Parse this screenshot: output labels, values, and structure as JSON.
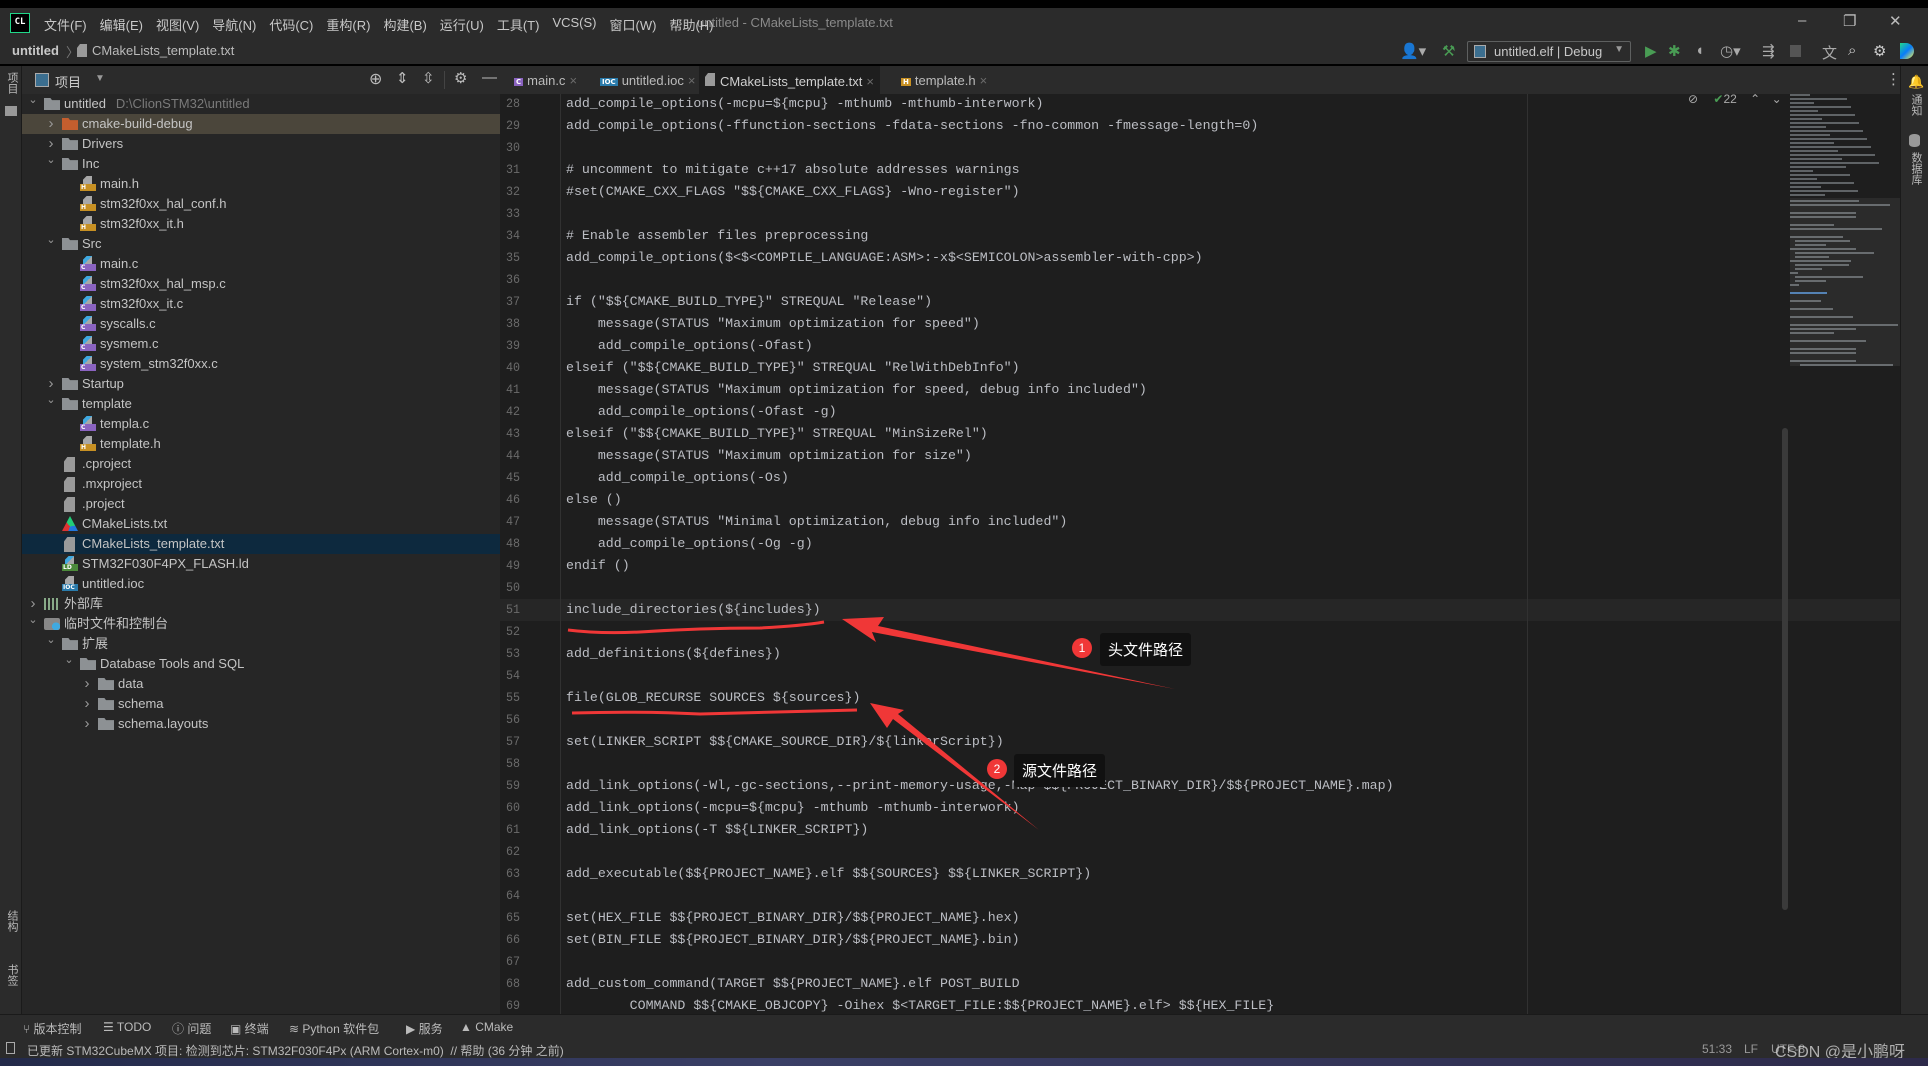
{
  "app": {
    "logo_text": "CL",
    "window_title": "untitled - CMakeLists_template.txt",
    "menu": [
      "文件(F)",
      "编辑(E)",
      "视图(V)",
      "导航(N)",
      "代码(C)",
      "重构(R)",
      "构建(B)",
      "运行(U)",
      "工具(T)",
      "VCS(S)",
      "窗口(W)",
      "帮助(H)"
    ],
    "window_controls": {
      "minimize": "–",
      "restore": "❐",
      "close": "✕"
    }
  },
  "breadcrumb": {
    "project": "untitled",
    "file": "CMakeLists_template.txt"
  },
  "toolbar": {
    "run_config": "untitled.elf | Debug",
    "accent_run": "#499c54"
  },
  "project_panel": {
    "title": "项目",
    "tree": [
      {
        "label": "untitled",
        "extra": "D:\\ClionSTM32\\untitled",
        "level": 0,
        "type": "folder",
        "chev": "open"
      },
      {
        "label": "cmake-build-debug",
        "level": 1,
        "type": "folder-orange",
        "chev": "closed",
        "state": "highlight"
      },
      {
        "label": "Drivers",
        "level": 1,
        "type": "folder",
        "chev": "closed"
      },
      {
        "label": "Inc",
        "level": 1,
        "type": "folder",
        "chev": "open"
      },
      {
        "label": "main.h",
        "level": 2,
        "type": "h"
      },
      {
        "label": "stm32f0xx_hal_conf.h",
        "level": 2,
        "type": "h"
      },
      {
        "label": "stm32f0xx_it.h",
        "level": 2,
        "type": "h"
      },
      {
        "label": "Src",
        "level": 1,
        "type": "folder",
        "chev": "open"
      },
      {
        "label": "main.c",
        "level": 2,
        "type": "c"
      },
      {
        "label": "stm32f0xx_hal_msp.c",
        "level": 2,
        "type": "c"
      },
      {
        "label": "stm32f0xx_it.c",
        "level": 2,
        "type": "c"
      },
      {
        "label": "syscalls.c",
        "level": 2,
        "type": "c"
      },
      {
        "label": "sysmem.c",
        "level": 2,
        "type": "c"
      },
      {
        "label": "system_stm32f0xx.c",
        "level": 2,
        "type": "c"
      },
      {
        "label": "Startup",
        "level": 1,
        "type": "folder",
        "chev": "closed"
      },
      {
        "label": "template",
        "level": 1,
        "type": "folder",
        "chev": "open"
      },
      {
        "label": "templa.c",
        "level": 2,
        "type": "c"
      },
      {
        "label": "template.h",
        "level": 2,
        "type": "h"
      },
      {
        "label": ".cproject",
        "level": 1,
        "type": "txt"
      },
      {
        "label": ".mxproject",
        "level": 1,
        "type": "txt"
      },
      {
        "label": ".project",
        "level": 1,
        "type": "txt"
      },
      {
        "label": "CMakeLists.txt",
        "level": 1,
        "type": "cmake"
      },
      {
        "label": "CMakeLists_template.txt",
        "level": 1,
        "type": "txt",
        "state": "selected"
      },
      {
        "label": "STM32F030F4PX_FLASH.ld",
        "level": 1,
        "type": "ld"
      },
      {
        "label": "untitled.ioc",
        "level": 1,
        "type": "ioc"
      },
      {
        "label": "外部库",
        "level": 0,
        "type": "lib",
        "chev": "closed"
      },
      {
        "label": "临时文件和控制台",
        "level": 0,
        "type": "scratch",
        "chev": "open"
      },
      {
        "label": "扩展",
        "level": 1,
        "type": "folder",
        "chev": "open"
      },
      {
        "label": "Database Tools and SQL",
        "level": 2,
        "type": "folder",
        "chev": "open"
      },
      {
        "label": "data",
        "level": 3,
        "type": "folder",
        "chev": "closed"
      },
      {
        "label": "schema",
        "level": 3,
        "type": "folder",
        "chev": "closed"
      },
      {
        "label": "schema.layouts",
        "level": 3,
        "type": "folder",
        "chev": "closed"
      }
    ]
  },
  "tabs": [
    {
      "label": "main.c",
      "type": "c"
    },
    {
      "label": "untitled.ioc",
      "type": "ioc"
    },
    {
      "label": "CMakeLists_template.txt",
      "type": "txt",
      "active": true
    },
    {
      "label": "template.h",
      "type": "h"
    }
  ],
  "editor": {
    "first_line": 28,
    "current_line": 51,
    "inspection_count": "22",
    "lines": [
      "add_compile_options(-mcpu=${mcpu} -mthumb -mthumb-interwork)",
      "add_compile_options(-ffunction-sections -fdata-sections -fno-common -fmessage-length=0)",
      "",
      "# uncomment to mitigate c++17 absolute addresses warnings",
      "#set(CMAKE_CXX_FLAGS \"$${CMAKE_CXX_FLAGS} -Wno-register\")",
      "",
      "# Enable assembler files preprocessing",
      "add_compile_options($<$<COMPILE_LANGUAGE:ASM>:-x$<SEMICOLON>assembler-with-cpp>)",
      "",
      "if (\"$${CMAKE_BUILD_TYPE}\" STREQUAL \"Release\")",
      "    message(STATUS \"Maximum optimization for speed\")",
      "    add_compile_options(-Ofast)",
      "elseif (\"$${CMAKE_BUILD_TYPE}\" STREQUAL \"RelWithDebInfo\")",
      "    message(STATUS \"Maximum optimization for speed, debug info included\")",
      "    add_compile_options(-Ofast -g)",
      "elseif (\"$${CMAKE_BUILD_TYPE}\" STREQUAL \"MinSizeRel\")",
      "    message(STATUS \"Maximum optimization for size\")",
      "    add_compile_options(-Os)",
      "else ()",
      "    message(STATUS \"Minimal optimization, debug info included\")",
      "    add_compile_options(-Og -g)",
      "endif ()",
      "",
      "include_directories(${includes})",
      "",
      "add_definitions(${defines})",
      "",
      "file(GLOB_RECURSE SOURCES ${sources})",
      "",
      "set(LINKER_SCRIPT $${CMAKE_SOURCE_DIR}/${linkerScript})",
      "",
      "add_link_options(-Wl,-gc-sections,--print-memory-usage,-Map=$${PROJECT_BINARY_DIR}/$${PROJECT_NAME}.map)",
      "add_link_options(-mcpu=${mcpu} -mthumb -mthumb-interwork)",
      "add_link_options(-T $${LINKER_SCRIPT})",
      "",
      "add_executable($${PROJECT_NAME}.elf $${SOURCES} $${LINKER_SCRIPT})",
      "",
      "set(HEX_FILE $${PROJECT_BINARY_DIR}/$${PROJECT_NAME}.hex)",
      "set(BIN_FILE $${PROJECT_BINARY_DIR}/$${PROJECT_NAME}.bin)",
      "",
      "add_custom_command(TARGET $${PROJECT_NAME}.elf POST_BUILD",
      "        COMMAND $${CMAKE_OBJCOPY} -Oihex $<TARGET_FILE:$${PROJECT_NAME}.elf> $${HEX_FILE}"
    ]
  },
  "annotations": [
    {
      "number": "1",
      "text": "头文件路径",
      "color": "#f03737"
    },
    {
      "number": "2",
      "text": "源文件路径",
      "color": "#f03737"
    }
  ],
  "left_strip": {
    "project": "项目",
    "structure": "结构",
    "bookmarks": "书签"
  },
  "right_strip": {
    "notifications": "通知",
    "database": "数据库"
  },
  "bottom_tools": [
    "版本控制",
    "TODO",
    "问题",
    "终端",
    "Python 软件包",
    "服务",
    "CMake"
  ],
  "status": {
    "message": "已更新 STM32CubeMX 项目: 检测到芯片: STM32F030F4Px (ARM Cortex-m0)  // 帮助 (36 分钟 之前)",
    "position": "51:33",
    "line_sep": "LF",
    "encoding": "UTF-8",
    "watermark": "CSDN @是小鹏呀"
  }
}
